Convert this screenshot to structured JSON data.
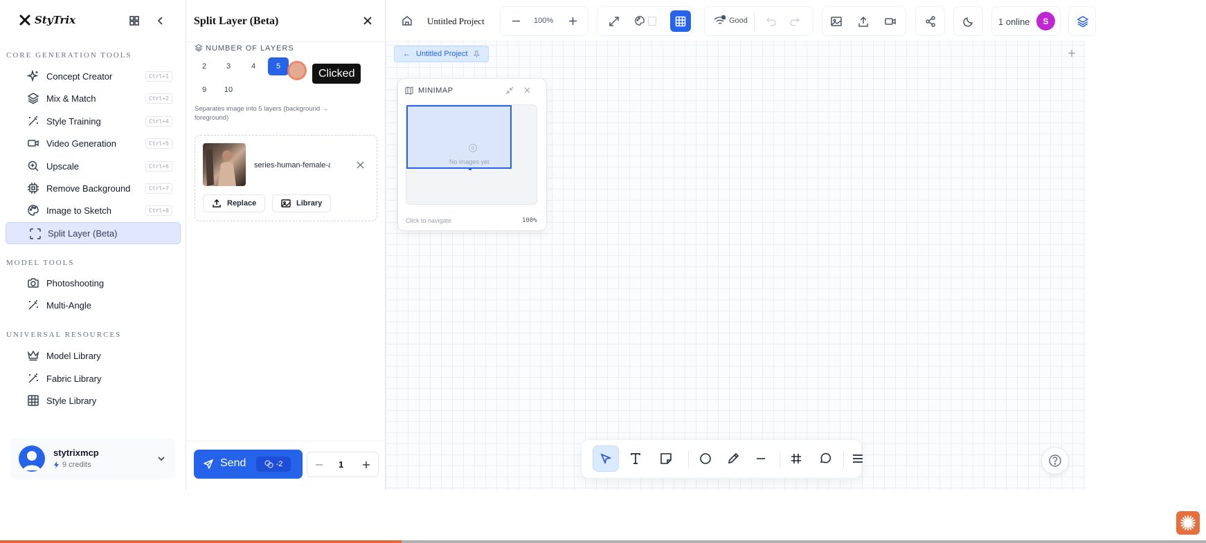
{
  "brand": {
    "name": "StyTrix"
  },
  "sidebar": {
    "sections": [
      {
        "title": "CORE GENERATION TOOLS"
      },
      {
        "title": "MODEL TOOLS"
      },
      {
        "title": "UNIVERSAL RESOURCES"
      }
    ],
    "core_items": [
      {
        "label": "Concept Creator",
        "shortcut": "Ctrl+1",
        "icon": "sparkle-icon"
      },
      {
        "label": "Mix & Match",
        "shortcut": "Ctrl+2",
        "icon": "layers-icon"
      },
      {
        "label": "Style Training",
        "shortcut": "Ctrl+4",
        "icon": "magic-wand-icon"
      },
      {
        "label": "Video Generation",
        "shortcut": "Ctrl+5",
        "icon": "video-icon"
      },
      {
        "label": "Upscale",
        "shortcut": "Ctrl+6",
        "icon": "zoom-in-icon"
      },
      {
        "label": "Remove Background",
        "shortcut": "Ctrl+7",
        "icon": "chip-icon"
      },
      {
        "label": "Image to Sketch",
        "shortcut": "Ctrl+8",
        "icon": "palette-icon"
      },
      {
        "label": "Split Layer (Beta)",
        "shortcut": "",
        "icon": "scan-icon",
        "active": true
      }
    ],
    "model_items": [
      {
        "label": "Photoshooting",
        "icon": "camera-icon"
      },
      {
        "label": "Multi-Angle",
        "icon": "magic-wand-icon"
      }
    ],
    "resource_items": [
      {
        "label": "Model Library",
        "icon": "crown-icon"
      },
      {
        "label": "Fabric Library",
        "icon": "magic-wand-icon"
      },
      {
        "label": "Style Library",
        "icon": "grid-icon"
      }
    ],
    "user": {
      "name": "stytrixmcp",
      "credits": "9 credits"
    }
  },
  "panel": {
    "title": "Split Layer (Beta)",
    "layers_label": "NUMBER OF LAYERS",
    "layer_options": [
      "2",
      "3",
      "4",
      "5",
      "9",
      "10"
    ],
    "selected_layers": "5",
    "tooltip": "Clicked",
    "description": "Separates image into 5 layers (background → foreground)",
    "file_name": "series-human-female-a...",
    "replace_label": "Replace",
    "library_label": "Library",
    "send_label": "Send",
    "cost": "-2",
    "quantity": "1"
  },
  "topbar": {
    "project_name": "Untitled Project",
    "zoom": "100%",
    "connection": "Good",
    "online": "1 online",
    "avatar_initial": "S"
  },
  "canvas": {
    "breadcrumb": "Untitled Project",
    "minimap": {
      "title": "MINIMAP",
      "empty": "No images yet",
      "hint": "Click to navigate",
      "zoom": "100%"
    }
  },
  "colors": {
    "accent": "#2563eb",
    "avatar": "#c026d3",
    "selected_layer": "#2563eb",
    "send_bg": "#2563eb",
    "progress": "#e06b3b",
    "fab": "#e76f3c"
  },
  "progress": {
    "fraction": 0.333
  }
}
